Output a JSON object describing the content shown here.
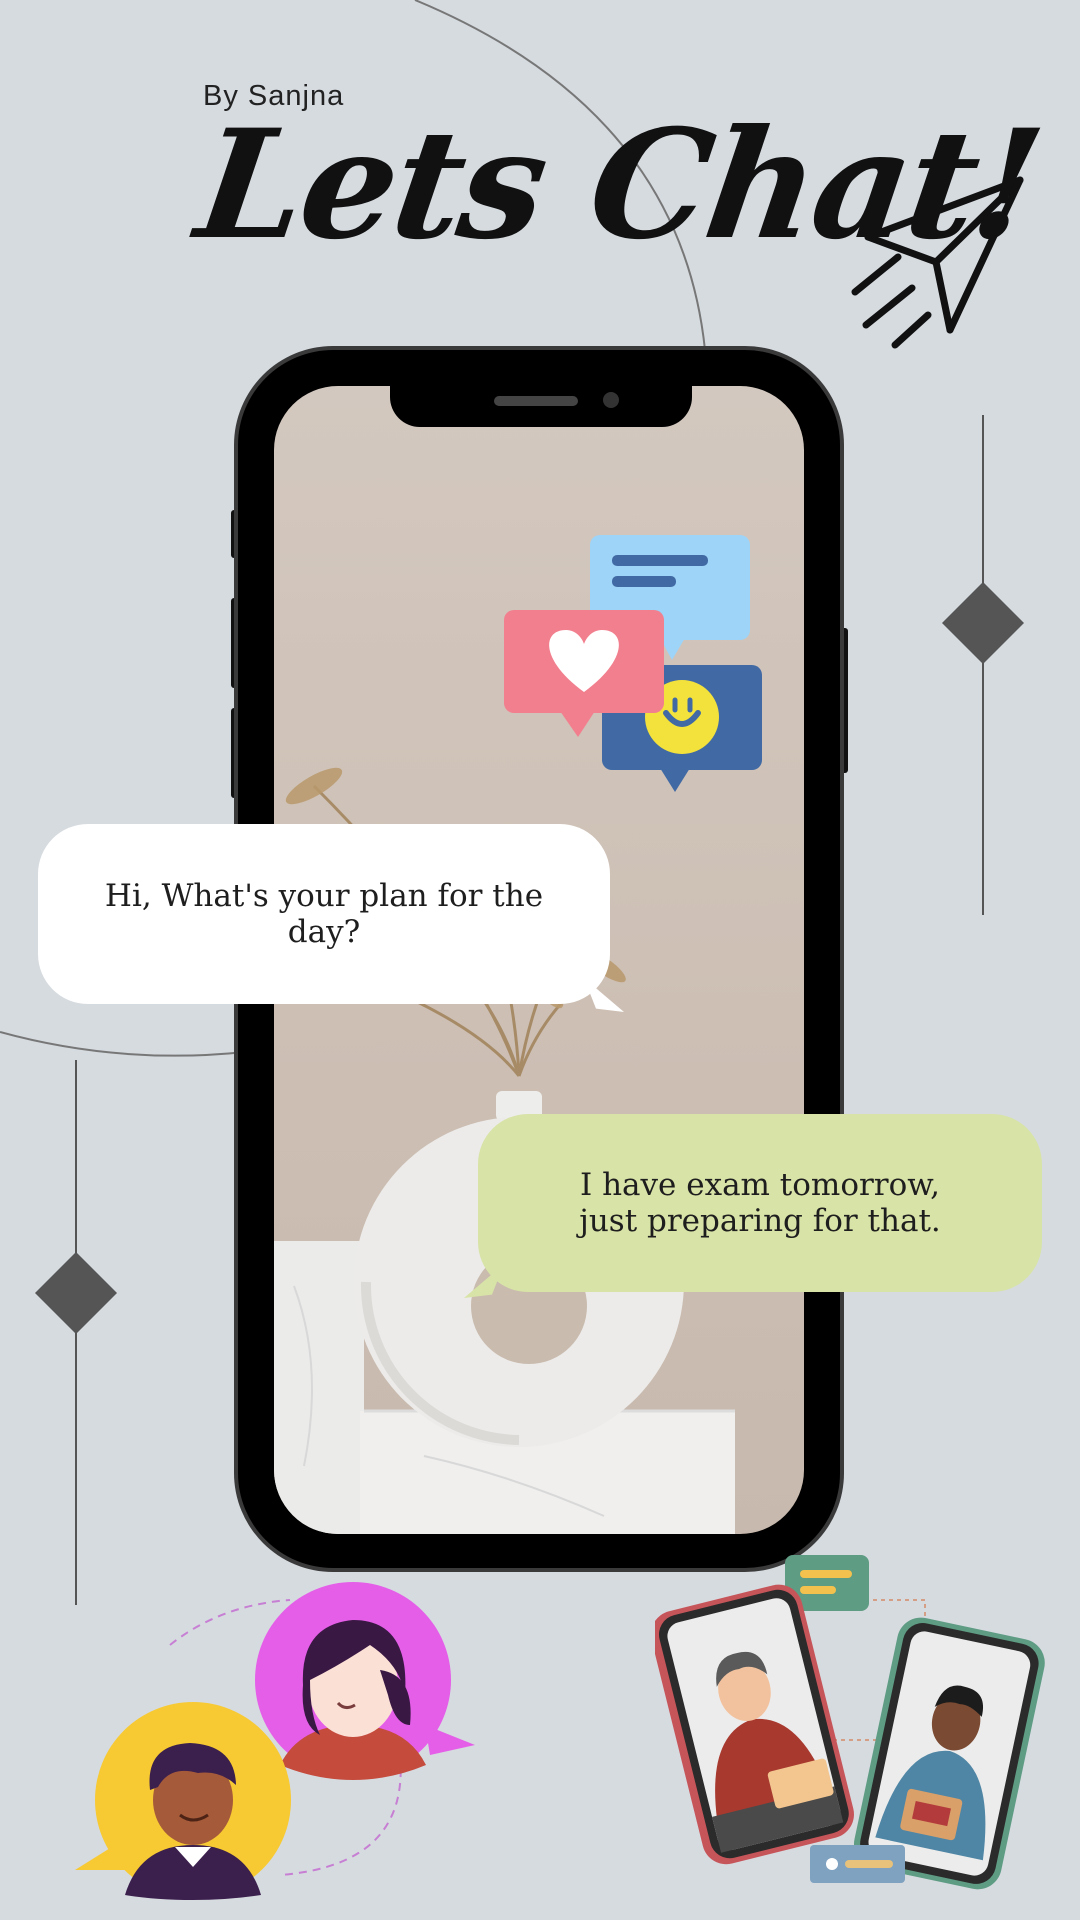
{
  "byline": "By Sanjna",
  "title": "Lets Chat!",
  "messages": [
    {
      "text": "Hi, What's your plan for the day?"
    },
    {
      "text": "I have exam tomorrow, just preparing for that."
    }
  ],
  "icons": [
    "paper-plane-icon",
    "message-icon",
    "heart-icon",
    "smile-icon",
    "diamond-icon",
    "woman-avatar-icon",
    "man-avatar-icon",
    "video-call-icon"
  ],
  "colors": {
    "background": "#d6dbe0",
    "bubble_white": "#ffffff",
    "bubble_green": "#d8e3a7",
    "chat_blue": "#9dd4f7",
    "chat_pink": "#f27f8e",
    "chat_navy": "#416aa5",
    "smile_yellow": "#f4e23c",
    "avatar_magenta": "#e45ee8",
    "avatar_yellow": "#f7c933"
  }
}
